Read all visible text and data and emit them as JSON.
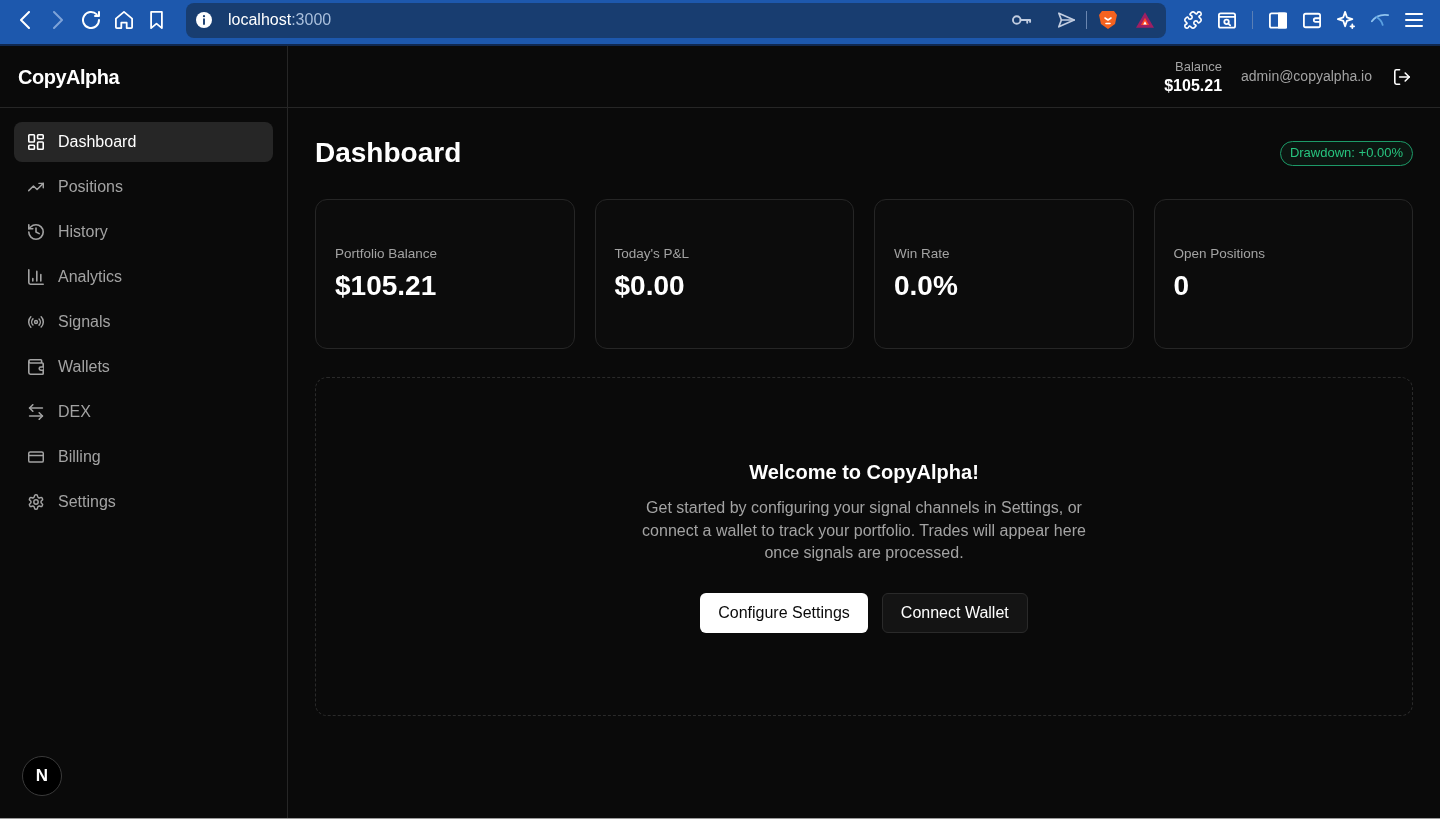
{
  "browser": {
    "back_disabled": false,
    "forward_disabled": true,
    "url_host": "localhost",
    "url_port": ":3000"
  },
  "sidebar": {
    "logo": "CopyAlpha",
    "items": [
      {
        "label": "Dashboard",
        "kind": "dashboard",
        "selected": true
      },
      {
        "label": "Positions",
        "kind": "positions",
        "selected": false
      },
      {
        "label": "History",
        "kind": "history",
        "selected": false
      },
      {
        "label": "Analytics",
        "kind": "analytics",
        "selected": false
      },
      {
        "label": "Signals",
        "kind": "signals",
        "selected": false
      },
      {
        "label": "Wallets",
        "kind": "wallets",
        "selected": false
      },
      {
        "label": "DEX",
        "kind": "dex",
        "selected": false
      },
      {
        "label": "Billing",
        "kind": "billing",
        "selected": false
      },
      {
        "label": "Settings",
        "kind": "settings",
        "selected": false
      }
    ],
    "dev_badge": "N"
  },
  "header": {
    "balance_label": "Balance",
    "balance_value": "$105.21",
    "email": "admin@copyalpha.io"
  },
  "page": {
    "title": "Dashboard",
    "drawdown_badge": "Drawdown: +0.00%"
  },
  "stats": [
    {
      "label": "Portfolio Balance",
      "value": "$105.21"
    },
    {
      "label": "Today's P&L",
      "value": "$0.00"
    },
    {
      "label": "Win Rate",
      "value": "0.0%"
    },
    {
      "label": "Open Positions",
      "value": "0"
    }
  ],
  "welcome": {
    "title": "Welcome to CopyAlpha!",
    "text": "Get started by configuring your signal channels in Settings, or connect a wallet to track your portfolio. Trades will appear here once signals are processed.",
    "buttons": [
      {
        "label": "Configure Settings",
        "kind": "primary"
      },
      {
        "label": "Connect Wallet",
        "kind": "secondary"
      }
    ]
  }
}
